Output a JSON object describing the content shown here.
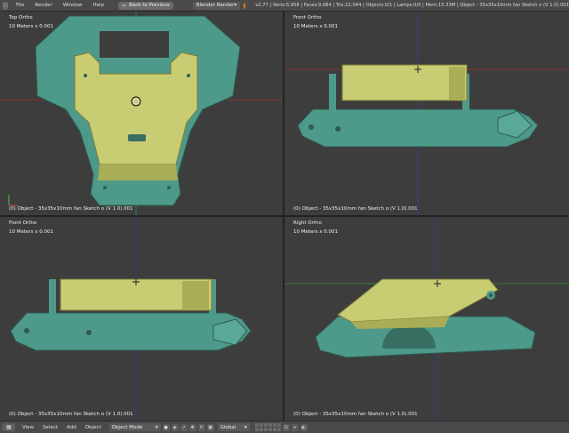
{
  "topbar": {
    "menus": [
      "File",
      "Render",
      "Window",
      "Help"
    ],
    "back_button": "Back to Previous",
    "render_engine": "Blender Render",
    "stats": "v2.77 | Verts:5,958 | Faces:9,084 | Tris:12,044 | Objects:0/1 | Lamps:0/0 | Mem:15.33M | Object - 35x35x10mm fan Sketch o (V 1.0).001"
  },
  "viewports": [
    {
      "name": "Top Ortho",
      "scale": "10 Meters x 0.001",
      "object": "(0) Object - 35x35x10mm fan Sketch o (V 1.0).001"
    },
    {
      "name": "Front Ortho",
      "scale": "10 Meters x 0.001",
      "object": "(0) Object - 35x35x10mm fan Sketch o (V 1.0).001"
    },
    {
      "name": "Front Ortho",
      "scale": "10 Meters x 0.001",
      "object": "(0) Object - 35x35x10mm fan Sketch o (V 1.0).001"
    },
    {
      "name": "Right Ortho",
      "scale": "10 Meters x 0.001",
      "object": "(0) Object - 35x35x10mm fan Sketch o (V 1.0).001"
    }
  ],
  "bottombar": {
    "menus": [
      "View",
      "Select",
      "Add",
      "Object"
    ],
    "mode": "Object Mode",
    "orientation": "Global"
  },
  "colors": {
    "teal": "#4e9a8a",
    "yellow": "#c8cc72",
    "background": "#3d3d3d"
  }
}
